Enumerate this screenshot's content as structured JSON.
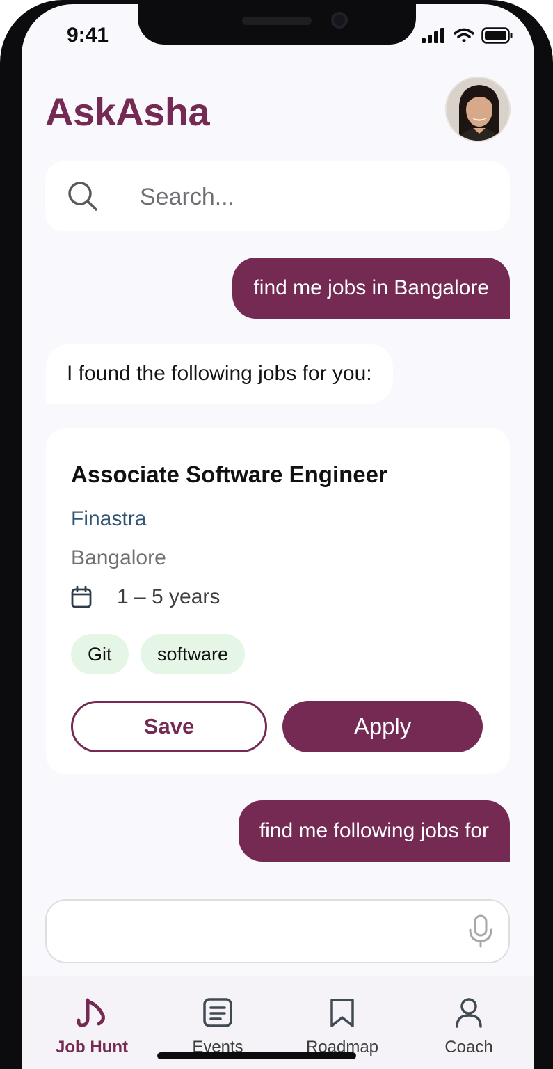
{
  "status_bar": {
    "time": "9:41"
  },
  "app": {
    "title": "AskAsha"
  },
  "search": {
    "placeholder": "Search..."
  },
  "messages": {
    "user_1": "find me jobs in Bangalore",
    "bot_1": "I found the following jobs for you:",
    "user_2": "find me following jobs for"
  },
  "job_card": {
    "title": "Associate Software Engineer",
    "company": "Finastra",
    "location": "Bangalore",
    "experience": "1 – 5 years",
    "tags": [
      "Git",
      "software"
    ],
    "save_label": "Save",
    "apply_label": "Apply"
  },
  "chat_input": {
    "value": "",
    "placeholder": ""
  },
  "bottom_nav": {
    "items": [
      {
        "label": "Job Hunt",
        "icon": "job-hunt-icon",
        "active": true
      },
      {
        "label": "Events",
        "icon": "events-icon",
        "active": false
      },
      {
        "label": "Roadmap",
        "icon": "bookmark-icon",
        "active": false
      },
      {
        "label": "Coach",
        "icon": "person-icon",
        "active": false
      }
    ]
  },
  "colors": {
    "brand": "#742a53",
    "company_link": "#2f5574",
    "tag_bg": "#e6f6e6",
    "screen_bg": "#f9f8fc"
  }
}
